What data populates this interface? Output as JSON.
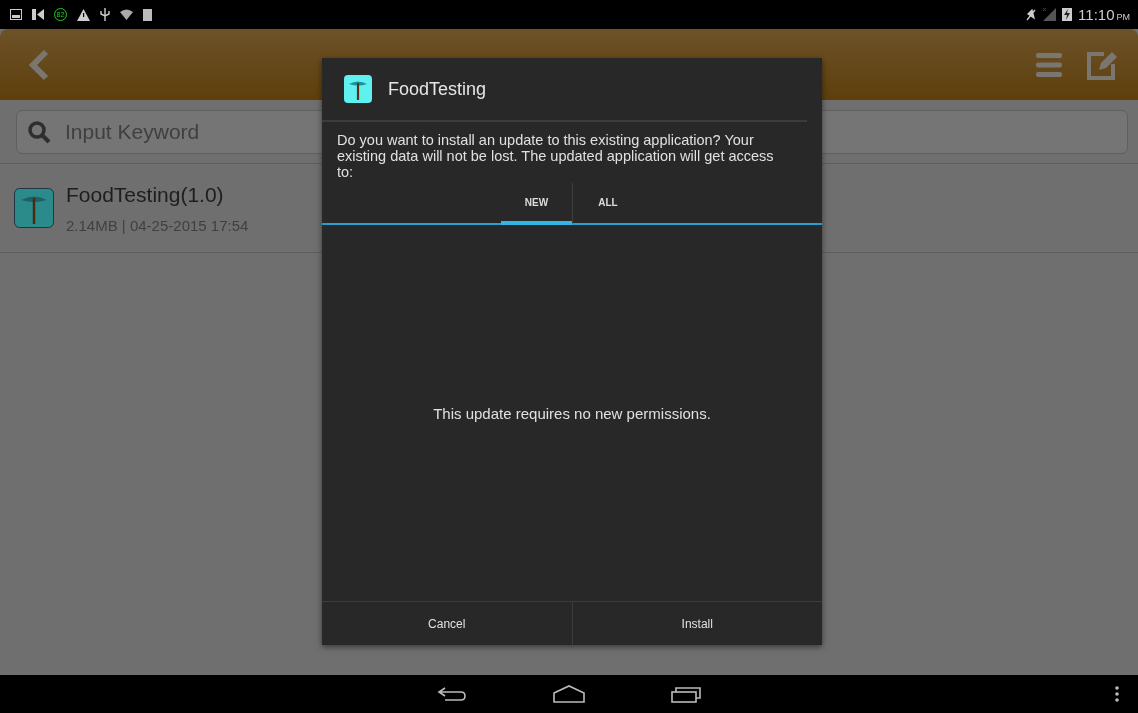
{
  "status_bar": {
    "battery_saver_badge": "82",
    "time": "11:10",
    "time_suffix": "PM"
  },
  "search": {
    "placeholder": "Input Keyword"
  },
  "apps": [
    {
      "name": "FoodTesting(1.0)",
      "details": "2.14MB | 04-25-2015 17:54"
    }
  ],
  "dialog": {
    "title": "FoodTesting",
    "message": "Do you want to install an update to this existing application? Your existing data will not be lost. The updated application will get access to:",
    "tabs": [
      {
        "label": "NEW",
        "selected": true
      },
      {
        "label": "ALL",
        "selected": false
      }
    ],
    "body": "This update requires no new permissions.",
    "buttons": [
      "Cancel",
      "Install"
    ]
  }
}
